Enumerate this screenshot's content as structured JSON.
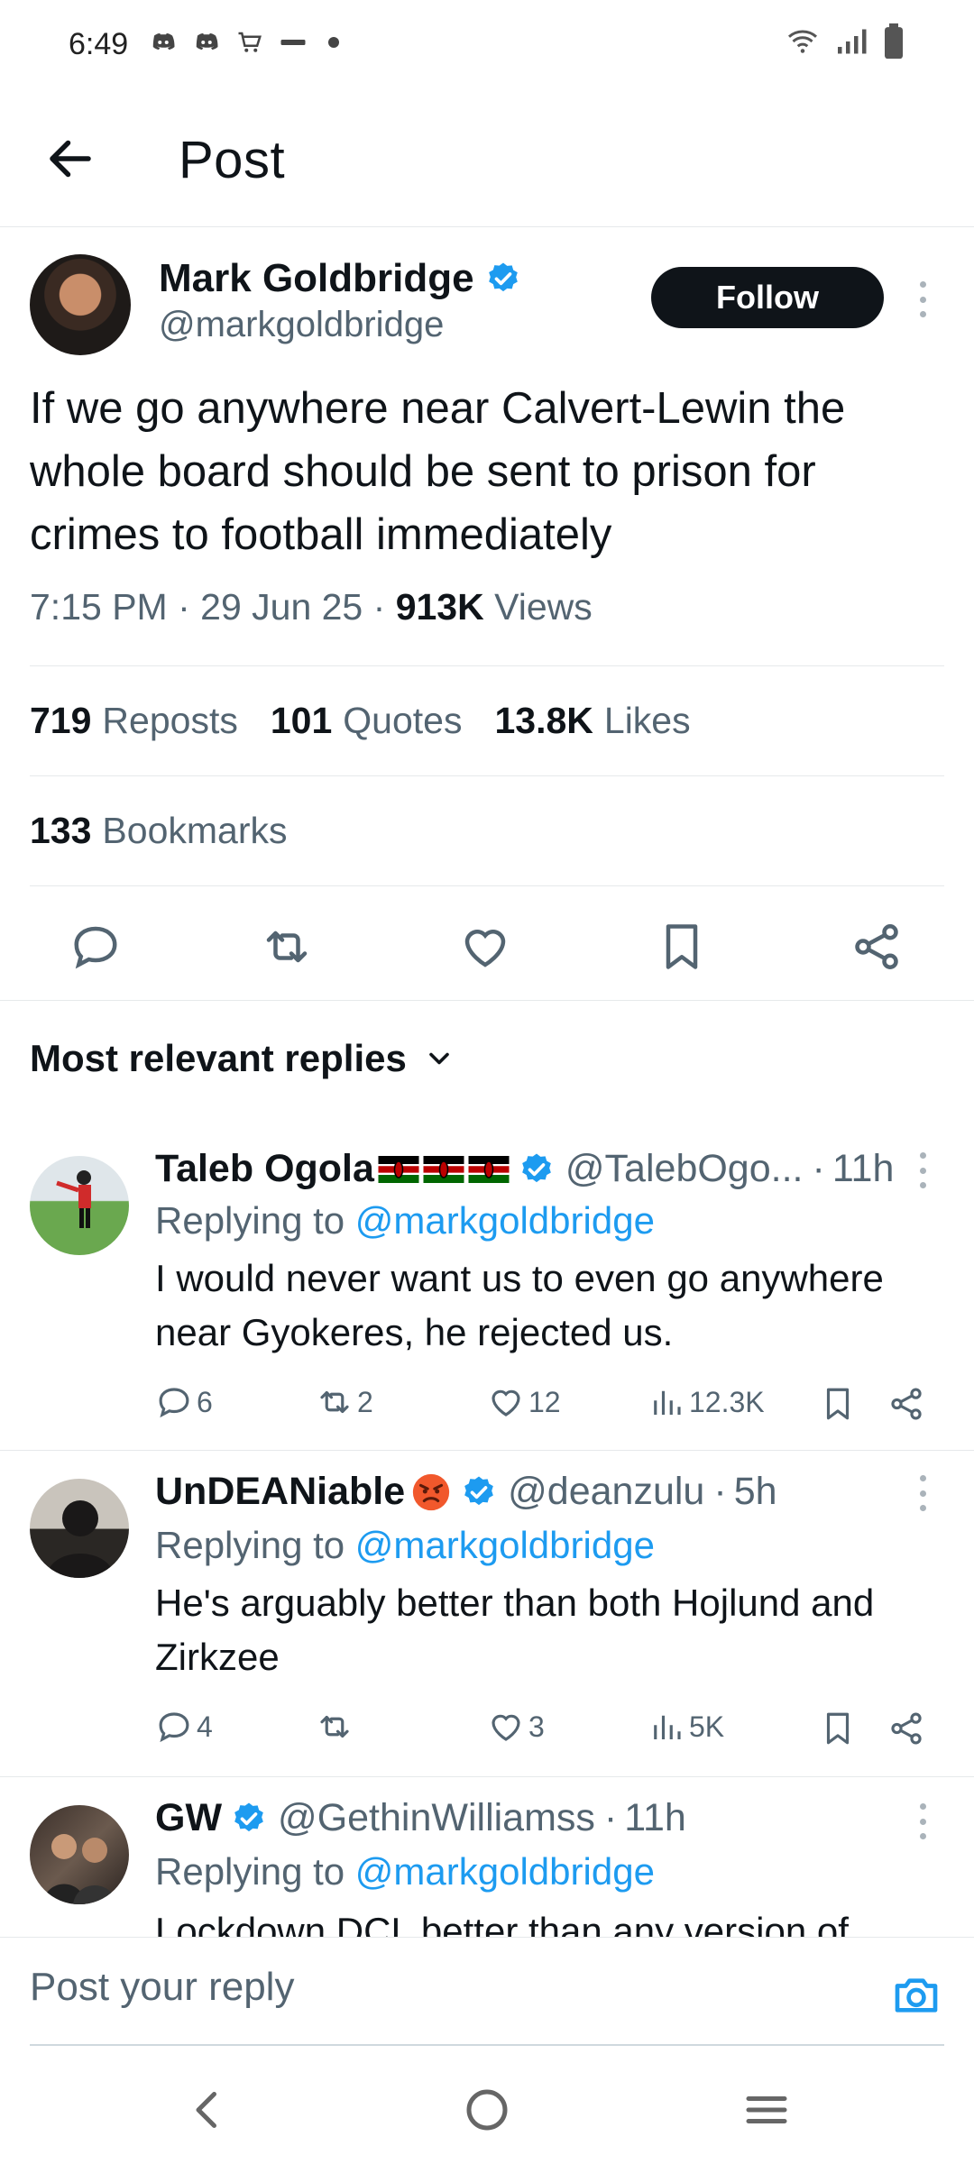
{
  "status_bar": {
    "time": "6:49",
    "left_icons": [
      "discord-icon",
      "discord-icon",
      "cart-icon",
      "snack-icon",
      "dot"
    ],
    "right_icons": [
      "wifi-icon",
      "signal-icon",
      "battery-icon"
    ]
  },
  "header": {
    "title": "Post",
    "back_icon": "arrow-left-icon"
  },
  "post": {
    "author_name": "Mark Goldbridge",
    "author_handle": "@markgoldbridge",
    "follow_label": "Follow",
    "text": "If we go anywhere near Calvert-Lewin the whole board should be sent to prison for crimes to football immediately",
    "time": "7:15 PM",
    "date": "29 Jun 25",
    "views_count": "913K",
    "views_label": "Views",
    "reposts_count": "719",
    "reposts_label": "Reposts",
    "quotes_count": "101",
    "quotes_label": "Quotes",
    "likes_count": "13.8K",
    "likes_label": "Likes",
    "bookmarks_count": "133",
    "bookmarks_label": "Bookmarks"
  },
  "sort": {
    "label": "Most relevant replies"
  },
  "replies": [
    {
      "name": "Taleb Ogola",
      "handle": "@TalebOgo...",
      "time": "11h",
      "replying_prefix": "Replying to",
      "replying_to": "@markgoldbridge",
      "text": "I would never want us to even go anywhere near Gyokeres, he rejected us.",
      "comments": "6",
      "reposts": "2",
      "likes": "12",
      "views": "12.3K"
    },
    {
      "name": "UnDEANiable",
      "handle": "@deanzulu",
      "time": "5h",
      "replying_prefix": "Replying to",
      "replying_to": "@markgoldbridge",
      "text": "He's arguably better than both Hojlund and Zirkzee",
      "comments": "4",
      "reposts": "",
      "likes": "3",
      "views": "5K"
    },
    {
      "name": "GW",
      "handle": "@GethinWilliamss",
      "time": "11h",
      "replying_prefix": "Replying to",
      "replying_to": "@markgoldbridge",
      "text": "Lockdown DCL better than any version of"
    }
  ],
  "compose": {
    "placeholder": "Post your reply"
  },
  "colors": {
    "accent": "#1d9bf0",
    "text": "#0f1419",
    "muted": "#536471",
    "follow_bg": "#0f1419"
  }
}
